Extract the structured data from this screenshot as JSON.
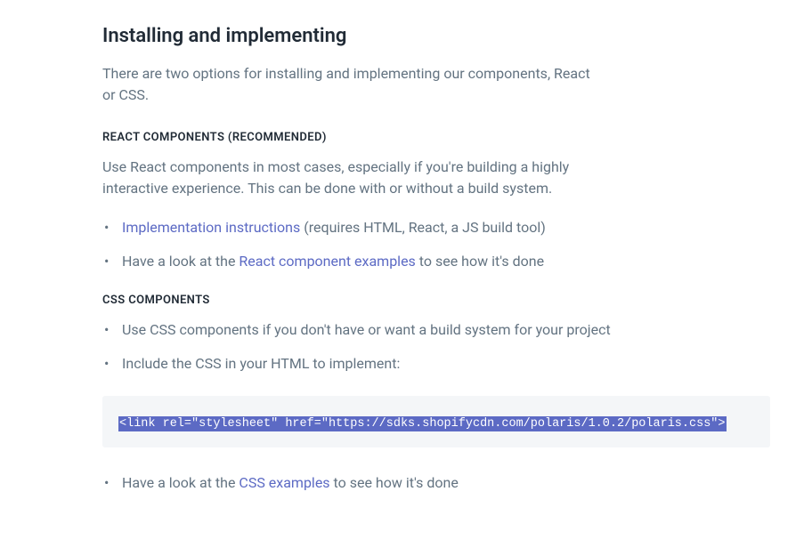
{
  "heading": "Installing and implementing",
  "intro": "There are two options for installing and implementing our components, React or CSS.",
  "react": {
    "title": "REACT COMPONENTS (RECOMMENDED)",
    "desc": "Use React components in most cases, especially if you're building a highly interactive experience. This can be done with or without a build system.",
    "items": [
      {
        "link": "Implementation instructions",
        "suffix": " (requires HTML, React, a JS build tool)"
      },
      {
        "prefix": "Have a look at the ",
        "link": "React component examples",
        "suffix": " to see how it's done"
      }
    ]
  },
  "css": {
    "title": "CSS COMPONENTS",
    "items": [
      {
        "text": "Use CSS components if you don't have or want a build system for your project"
      },
      {
        "text": "Include the CSS in your HTML to implement:"
      }
    ],
    "code": "<link rel=\"stylesheet\" href=\"https://sdks.shopifycdn.com/polaris/1.0.2/polaris.css\">",
    "after_items": [
      {
        "prefix": "Have a look at the ",
        "link": "CSS examples",
        "suffix": " to see how it's done"
      }
    ]
  }
}
